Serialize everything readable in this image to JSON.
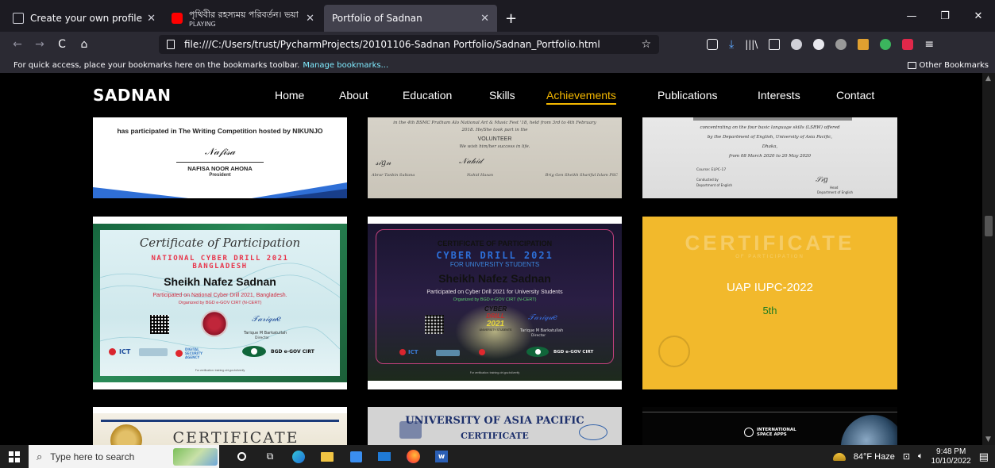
{
  "browser": {
    "tabs": [
      {
        "title": "Create your own profile",
        "subtitle": "",
        "active": false
      },
      {
        "title": "পৃথিবীর রহস্যময় পরিবর্তন। ভয়া",
        "subtitle": "PLAYING",
        "active": false
      },
      {
        "title": "Portfolio of Sadnan",
        "subtitle": "",
        "active": true
      }
    ],
    "new_tab": "+",
    "url": "file:///C:/Users/trust/PycharmProjects/20101106-Sadnan Portfolio/Sadnan_Portfolio.html",
    "bookmarks_text": "For quick access, place your bookmarks here on the bookmarks toolbar.",
    "bookmarks_link": "Manage bookmarks...",
    "other_bookmarks": "Other Bookmarks"
  },
  "site": {
    "logo": "SADNAN",
    "menu": [
      "Home",
      "About",
      "Education",
      "Skills",
      "Achievements",
      "Publications",
      "Interests",
      "Contact"
    ],
    "active_menu": "Achievements"
  },
  "certs": {
    "top_left": {
      "line": "has participated in The Writing Competition hosted by NIKUNJO",
      "name": "NAFISA NOOR AHONA",
      "role": "President"
    },
    "top_mid": {
      "line1": "in the 4th BSMC Pratham Alo National Art & Music Fest '18, held from 3rd to 4th February",
      "line2": "2018. He/She took part in the",
      "role": "VOLUNTEER",
      "wish": "We wish him/her success in life.",
      "sig1": "Abrar Tanbin Sultana",
      "sig2": "Nahid Hasan",
      "sig3": "Brig Gen Sheikh Shariful Islam PSC"
    },
    "top_right": {
      "line1": "concentrating on the four basic language skills (LSRW) offered",
      "line2": "by the Department of English, University of Asia Pacific,",
      "line3": "Dhaka,",
      "line4": "from 08 March 2020 to 20 May 2020",
      "course": "Course: ELPC-17",
      "by": "Conducted by",
      "dept": "Department of English",
      "head": "Head",
      "dept2": "Department of English"
    },
    "ncd": {
      "title": "Certificate of Participation",
      "event": "NATIONAL CYBER DRILL 2021",
      "country": "BANGLADESH",
      "name": "Sheikh Nafez Sadnan",
      "desc": "Participated on National Cyber Drill 2021, Bangladesh.",
      "org": "Organized by BGD e-GOV CIRT (N-CERT)",
      "signer": "Tarique M Barkatullah",
      "signer_role": "Director",
      "logo1": "ICT",
      "logo2": "DIGITAL SECURITY AGENCY",
      "logo3": "BGD e-GOV CIRT",
      "footer": "For verification: training.cirt.gov.bd/verify"
    },
    "cdu": {
      "title": "CERTIFICATE OF PARTICIPATION",
      "event": "CYBER DRILL 2021",
      "sub": "FOR UNIVERSITY STUDENTS",
      "name": "Sheikh Nafez Sadnan",
      "desc": "Participated on Cyber Drill 2021 for University Students",
      "org": "Organized by BGD e-GOV CIRT (N-CERT)",
      "badge1": "CYBER",
      "badge2": "DRILL",
      "badge3": "2021",
      "badge4": "UNIVERSITY STUDENTS",
      "signer": "Tarique M Barkatullah",
      "signer_role": "Director",
      "logo1": "ICT",
      "logo3": "BGD e-GOV CIRT",
      "footer": "For verification: training.cirt.gov.bd/verify"
    },
    "iupc": {
      "bg_word": "CERTIFICATE",
      "bg_sub": "OF PARTICIPATION",
      "title": "UAP IUPC-2022",
      "rank": "5th"
    },
    "bottom_left": {
      "title": "CERTIFICATE"
    },
    "bottom_mid": {
      "title": "UNIVERSITY OF ASIA PACIFIC",
      "sub": "CERTIFICATE"
    },
    "bottom_right": {
      "label": "INTERNATIONAL SPACE APPS"
    }
  },
  "taskbar": {
    "search_placeholder": "Type here to search",
    "weather": "84°F Haze",
    "time": "9:48 PM",
    "date": "10/10/2022"
  },
  "colors": {
    "accent": "#f5b800",
    "iupc_bg": "#f2b92c",
    "ncd_green": "#1f7a4a"
  }
}
